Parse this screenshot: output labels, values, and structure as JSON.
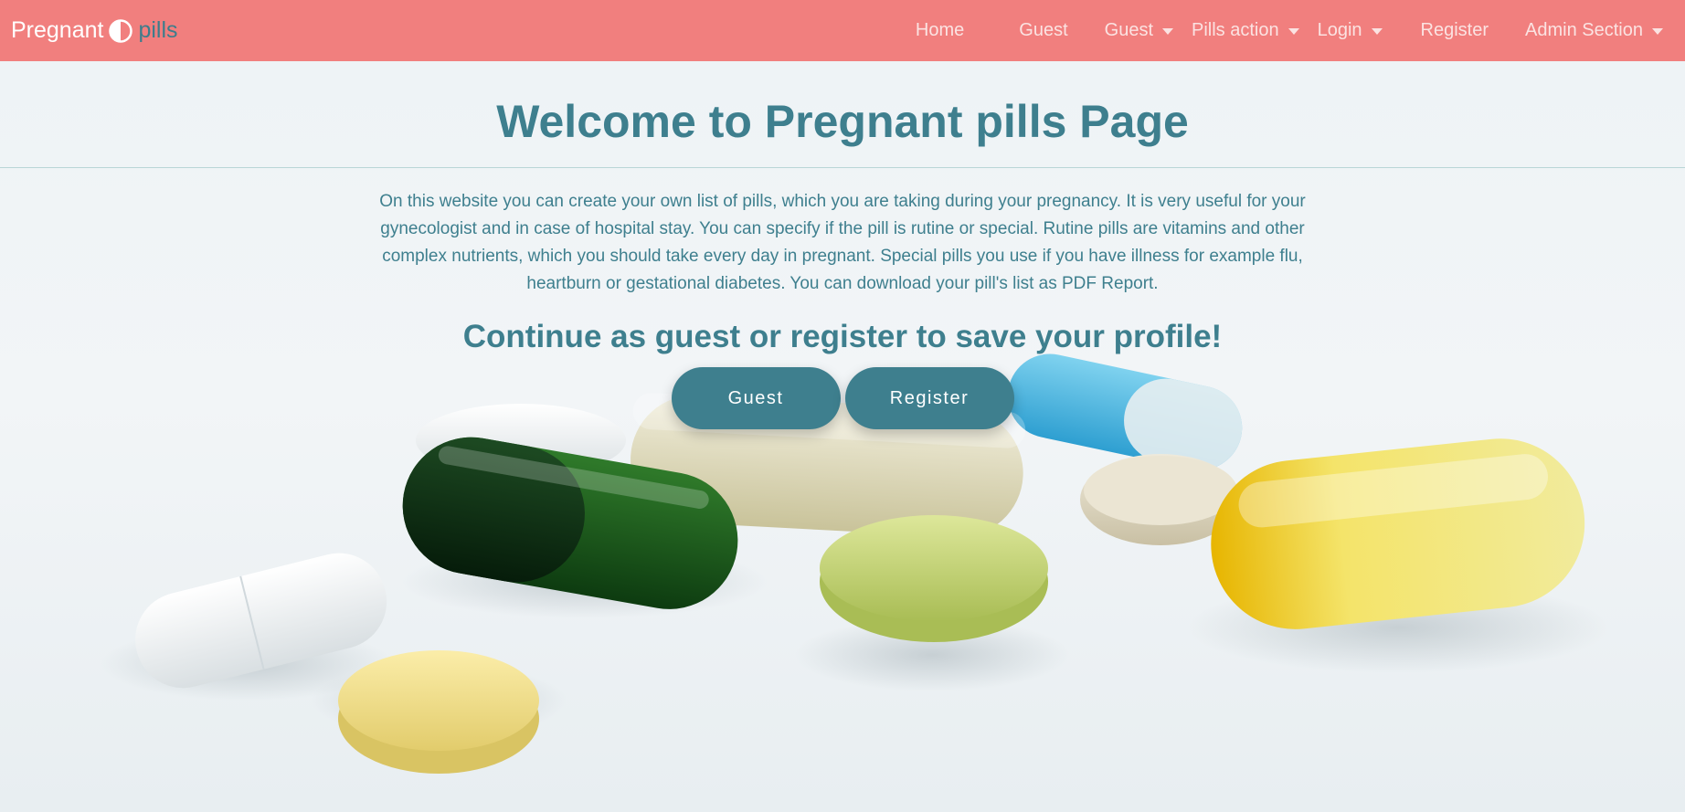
{
  "brand": {
    "part1": "Pregnant",
    "part2": "pills",
    "icon": "half-circle-icon"
  },
  "nav": {
    "items": [
      {
        "label": "Home",
        "dropdown": false
      },
      {
        "label": "Guest",
        "dropdown": false
      },
      {
        "label": "Guest",
        "dropdown": true
      },
      {
        "label": "Pills action",
        "dropdown": true
      },
      {
        "label": "Login",
        "dropdown": true
      },
      {
        "label": "Register",
        "dropdown": false
      },
      {
        "label": "Admin Section",
        "dropdown": true
      }
    ]
  },
  "main": {
    "title": "Welcome to Pregnant pills Page",
    "description": "On this website you can create your own list of pills, which you are taking during your pregnancy. It is very useful for your gynecologist and in case of hospital stay. You can specify if the pill is rutine or special. Rutine pills are vitamins and other complex nutrients, which you should take every day in pregnant. Special pills you use if you have illness for example flu, heartburn or gestational diabetes. You can download your pill's list as PDF Report.",
    "subtitle": "Continue as guest or register to save your profile!",
    "buttons": {
      "guest": "Guest",
      "register": "Register"
    }
  },
  "colors": {
    "navbar": "#f17f7e",
    "accent": "#3e7f8e",
    "background": "#eef3f6"
  }
}
